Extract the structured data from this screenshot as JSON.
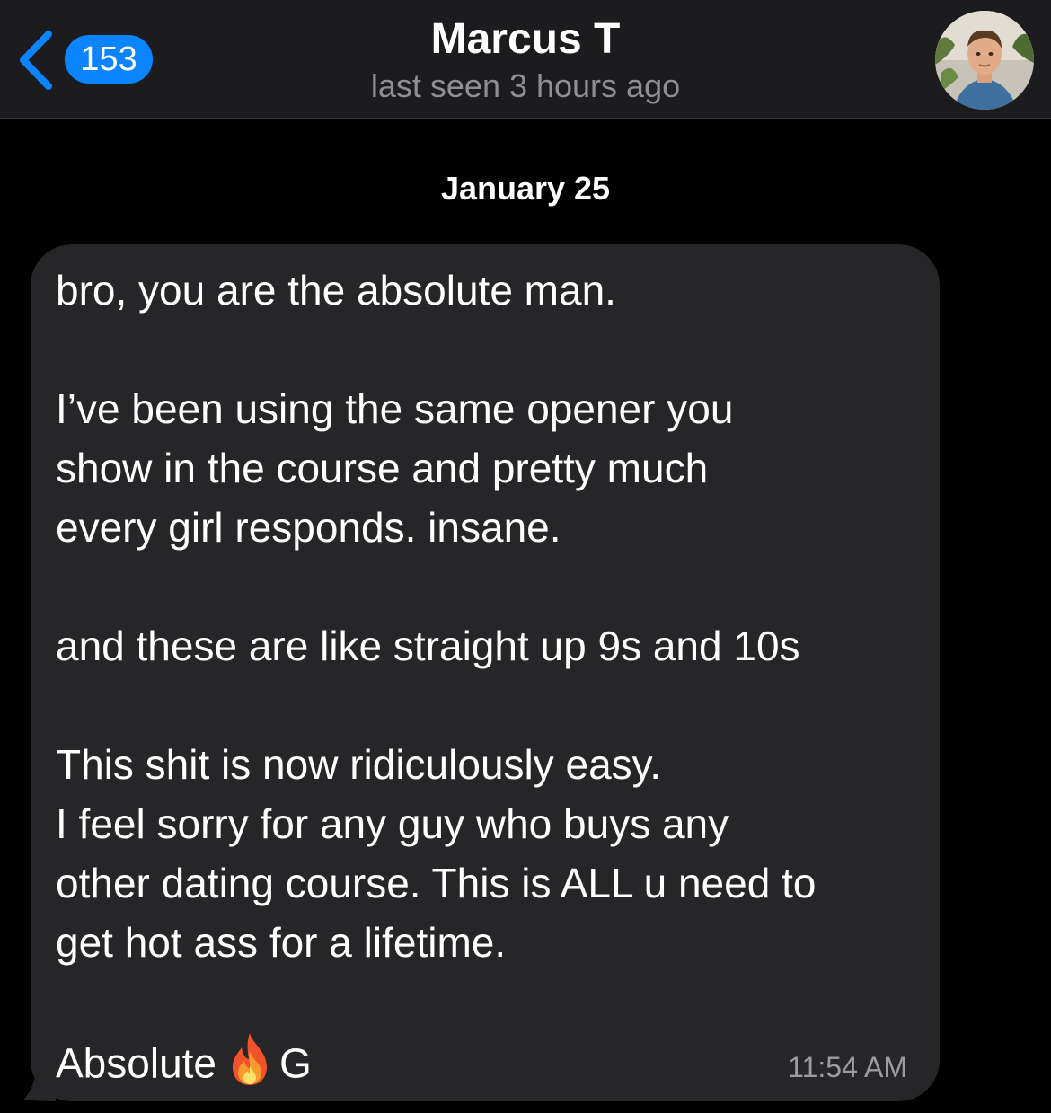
{
  "header": {
    "back_badge": "153",
    "contact_name": "Marcus T",
    "status": "last seen 3 hours ago"
  },
  "chat": {
    "date_separator": "January 25",
    "message": {
      "paragraphs": [
        "bro, you are the absolute man.",
        "I’ve been using the same opener you\nshow in the course and pretty much\nevery girl responds. insane.",
        "and these are like straight up 9s and 10s",
        "This shit is now ridiculously easy.\nI feel sorry for any guy who buys any\nother dating course. This is ALL u need to\nget hot ass for a lifetime."
      ],
      "last_line_before": "Absolute",
      "last_line_emoji": "fire-icon",
      "last_line_after": "G",
      "time": "11:54 AM"
    }
  },
  "colors": {
    "background": "#000000",
    "header_bg": "#1c1c1e",
    "bubble_bg": "#262628",
    "accent": "#0a84ff",
    "secondary_text": "#8e8e93"
  }
}
